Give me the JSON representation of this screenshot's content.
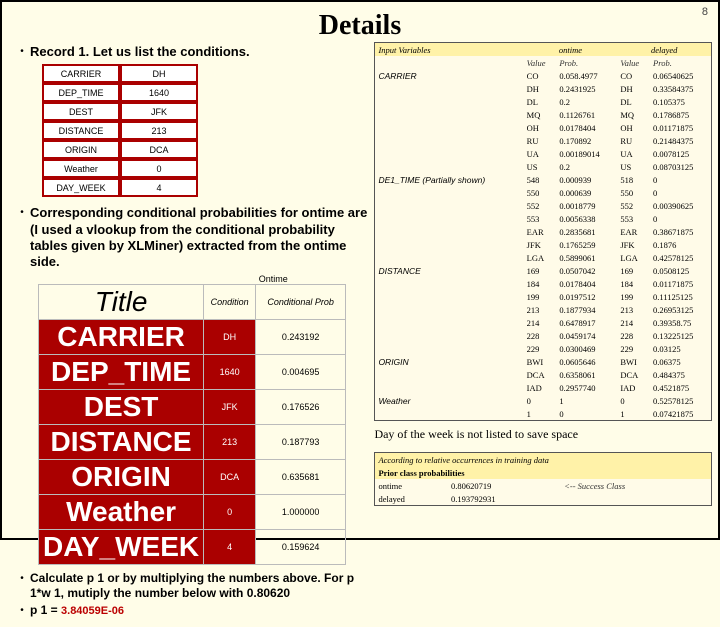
{
  "page_number": "8",
  "title": "Details",
  "bullets": {
    "b1": "Record 1.  Let us list the conditions.",
    "b2": "Corresponding conditional probabilities for ontime are (I used a vlookup from the conditional probability tables given by XLMiner) extracted from the ontime side.",
    "b3": "Calculate p 1 or by multiplying the numbers above.   For p 1*w 1, mutiply the number below with 0.80620",
    "b4_prefix": "p 1 =  ",
    "b4_value": "3.84059E-06"
  },
  "conditions": [
    {
      "label": "CARRIER",
      "value": "DH"
    },
    {
      "label": "DEP_TIME",
      "value": "1640"
    },
    {
      "label": "DEST",
      "value": "JFK"
    },
    {
      "label": "DISTANCE",
      "value": "213"
    },
    {
      "label": "ORIGIN",
      "value": "DCA"
    },
    {
      "label": "Weather",
      "value": "0"
    },
    {
      "label": "DAY_WEEK",
      "value": "4"
    }
  ],
  "prob_table": {
    "ontime_label": "Ontime",
    "headers": {
      "c1": "Title",
      "c2": "Condition",
      "c3": "Conditional Prob"
    },
    "rows": [
      {
        "t": "CARRIER",
        "c": "DH",
        "p": "0.243192"
      },
      {
        "t": "DEP_TIME",
        "c": "1640",
        "p": "0.004695"
      },
      {
        "t": "DEST",
        "c": "JFK",
        "p": "0.176526"
      },
      {
        "t": "DISTANCE",
        "c": "213",
        "p": "0.187793"
      },
      {
        "t": "ORIGIN",
        "c": "DCA",
        "p": "0.635681"
      },
      {
        "t": "Weather",
        "c": "0",
        "p": "1.000000"
      },
      {
        "t": "DAY_WEEK",
        "c": "4",
        "p": "0.159624"
      }
    ]
  },
  "right": {
    "input_hdr": "Input Variables",
    "ontime_hdr": "ontime",
    "delayed_hdr": "delayed",
    "value_hdr": "Value",
    "prob_hdr": "Prob.",
    "carrier_lbl": "CARRIER",
    "carrier_rows": [
      {
        "v": "CO",
        "p1": "0.058.4977",
        "p2": "CO",
        "p3": "0.06540625"
      },
      {
        "v": "DH",
        "p1": "0.2431925",
        "p2": "DH",
        "p3": "0.33584375"
      },
      {
        "v": "DL",
        "p1": "0.2",
        "p2": "DL",
        "p3": "0.105375"
      },
      {
        "v": "MQ",
        "p1": "0.1126761",
        "p2": "MQ",
        "p3": "0.1786875"
      },
      {
        "v": "OH",
        "p1": "0.0178404",
        "p2": "OH",
        "p3": "0.01171875"
      },
      {
        "v": "RU",
        "p1": "0.170892",
        "p2": "RU",
        "p3": "0.21484375"
      },
      {
        "v": "UA",
        "p1": "0.00189014",
        "p2": "UA",
        "p3": "0.0078125"
      },
      {
        "v": "US",
        "p1": "0.2",
        "p2": "US",
        "p3": "0.08703125"
      }
    ],
    "deptime_lbl": "DE1_TIME (Partially shown)",
    "deptime_rows": [
      {
        "v": "548",
        "p1": "0.000939",
        "p2": "518",
        "p3": "0"
      },
      {
        "v": "550",
        "p1": "0.000639",
        "p2": "550",
        "p3": "0"
      },
      {
        "v": "552",
        "p1": "0.0018779",
        "p2": "552",
        "p3": "0.00390625"
      },
      {
        "v": "553",
        "p1": "0.0056338",
        "p2": "553",
        "p3": "0"
      },
      {
        "v": "EAR",
        "p1": "0.2835681",
        "p2": "EAR",
        "p3": "0.38671875"
      },
      {
        "v": "JFK",
        "p1": "0.1765259",
        "p2": "JFK",
        "p3": "0.1876"
      },
      {
        "v": "LGA",
        "p1": "0.5899061",
        "p2": "LGA",
        "p3": "0.42578125"
      }
    ],
    "distance_lbl": "DISTANCE",
    "distance_rows": [
      {
        "v": "169",
        "p1": "0.0507042",
        "p2": "169",
        "p3": "0.0508125"
      },
      {
        "v": "184",
        "p1": "0.0178404",
        "p2": "184",
        "p3": "0.01171875"
      },
      {
        "v": "199",
        "p1": "0.0197512",
        "p2": "199",
        "p3": "0.11125125"
      },
      {
        "v": "213",
        "p1": "0.1877934",
        "p2": "213",
        "p3": "0.26953125"
      },
      {
        "v": "214",
        "p1": "0.6478917",
        "p2": "214",
        "p3": "0.39358.75"
      },
      {
        "v": "228",
        "p1": "0.0459174",
        "p2": "228",
        "p3": "0.13225125"
      },
      {
        "v": "229",
        "p1": "0.0300469",
        "p2": "229",
        "p3": "0.03125"
      }
    ],
    "origin_lbl": "ORIGIN",
    "origin_rows": [
      {
        "v": "BWI",
        "p1": "0.0605646",
        "p2": "BWI",
        "p3": "0.06375"
      },
      {
        "v": "DCA",
        "p1": "0.6358061",
        "p2": "DCA",
        "p3": "0.484375"
      },
      {
        "v": "IAD",
        "p1": "0.2957740",
        "p2": "IAD",
        "p3": "0.4521875"
      }
    ],
    "weather_lbl": "Weather",
    "weather_rows": [
      {
        "v": "0",
        "p1": "1",
        "p2": "0",
        "p3": "0.52578125"
      },
      {
        "v": "1",
        "p1": "0",
        "p2": "1",
        "p3": "0.07421875"
      }
    ],
    "day_note": "Day of the week is not listed to save space",
    "prior_hdr": "According to relative occurrences in training data",
    "prior_lbl": "Prior class probabilities",
    "prior_rows": [
      {
        "c": "ontime",
        "p": "0.80620719"
      },
      {
        "c": "delayed",
        "p": "0.193792931"
      }
    ],
    "success_note": "<-- Success Class"
  }
}
